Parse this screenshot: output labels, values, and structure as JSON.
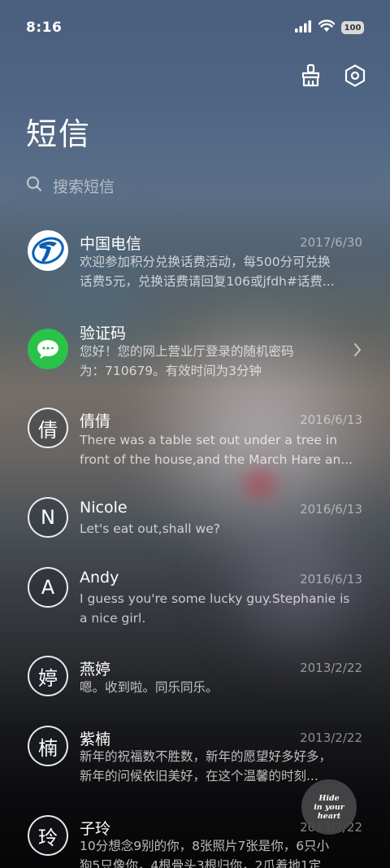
{
  "status_bar": {
    "time": "8:16",
    "battery": "100"
  },
  "header": {
    "title": "短信",
    "icons": [
      "broom-icon",
      "settings-hexagon-icon"
    ]
  },
  "search": {
    "placeholder": "搜索短信"
  },
  "conversations": [
    {
      "avatar_type": "telecom-logo",
      "name": "中国电信",
      "date": "2017/6/30",
      "preview_lines": [
        "欢迎参加积分兑换话费活动，每500分可兑换",
        "话费5元，兑换话费请回复106或jfdh#话费..."
      ]
    },
    {
      "avatar_type": "sms-icon",
      "name": "验证码",
      "date": "",
      "preview_lines": [
        "您好！您的网上营业厅登录的随机密码",
        "为：710679。有效时间为3分钟"
      ]
    },
    {
      "avatar_type": "letter",
      "avatar_letter": "倩",
      "name": "倩倩",
      "date": "2016/6/13",
      "preview_lines": [
        "There was a table set out under a tree in",
        "front of the house,and the March Hare an..."
      ]
    },
    {
      "avatar_type": "letter",
      "avatar_letter": "N",
      "name": "Nicole",
      "date": "2016/6/13",
      "preview_lines": [
        "Let's eat out,shall we?"
      ]
    },
    {
      "avatar_type": "letter",
      "avatar_letter": "A",
      "name": "Andy",
      "date": "2016/6/13",
      "preview_lines": [
        "I guess you're some lucky guy.Stephanie is",
        "a nice girl."
      ]
    },
    {
      "avatar_type": "letter",
      "avatar_letter": "婷",
      "name": "燕婷",
      "date": "2013/2/22",
      "preview_lines": [
        "嗯。收到啦。同乐同乐。"
      ]
    },
    {
      "avatar_type": "letter",
      "avatar_letter": "楠",
      "name": "紫楠",
      "date": "2013/2/22",
      "preview_lines": [
        "新年的祝福数不胜数，新年的愿望好多好多，",
        "新年的问候依旧美好，在这个温馨的时刻..."
      ]
    },
    {
      "avatar_type": "letter",
      "avatar_letter": "玲",
      "name": "子玲",
      "date": "2013/2/22",
      "preview_lines": [
        "10分想念9别的你，8张照片7张是你，6只小",
        "狗5只像你，4根骨头3根归你，2爪着地1定..."
      ]
    }
  ],
  "floating_badge": {
    "line1": "Hide",
    "line2": "in your",
    "line3": "heart"
  },
  "colors": {
    "sms_green": "#2ac349",
    "telecom_blue": "#0a5fb4",
    "search_bg": "#5a6e87"
  }
}
